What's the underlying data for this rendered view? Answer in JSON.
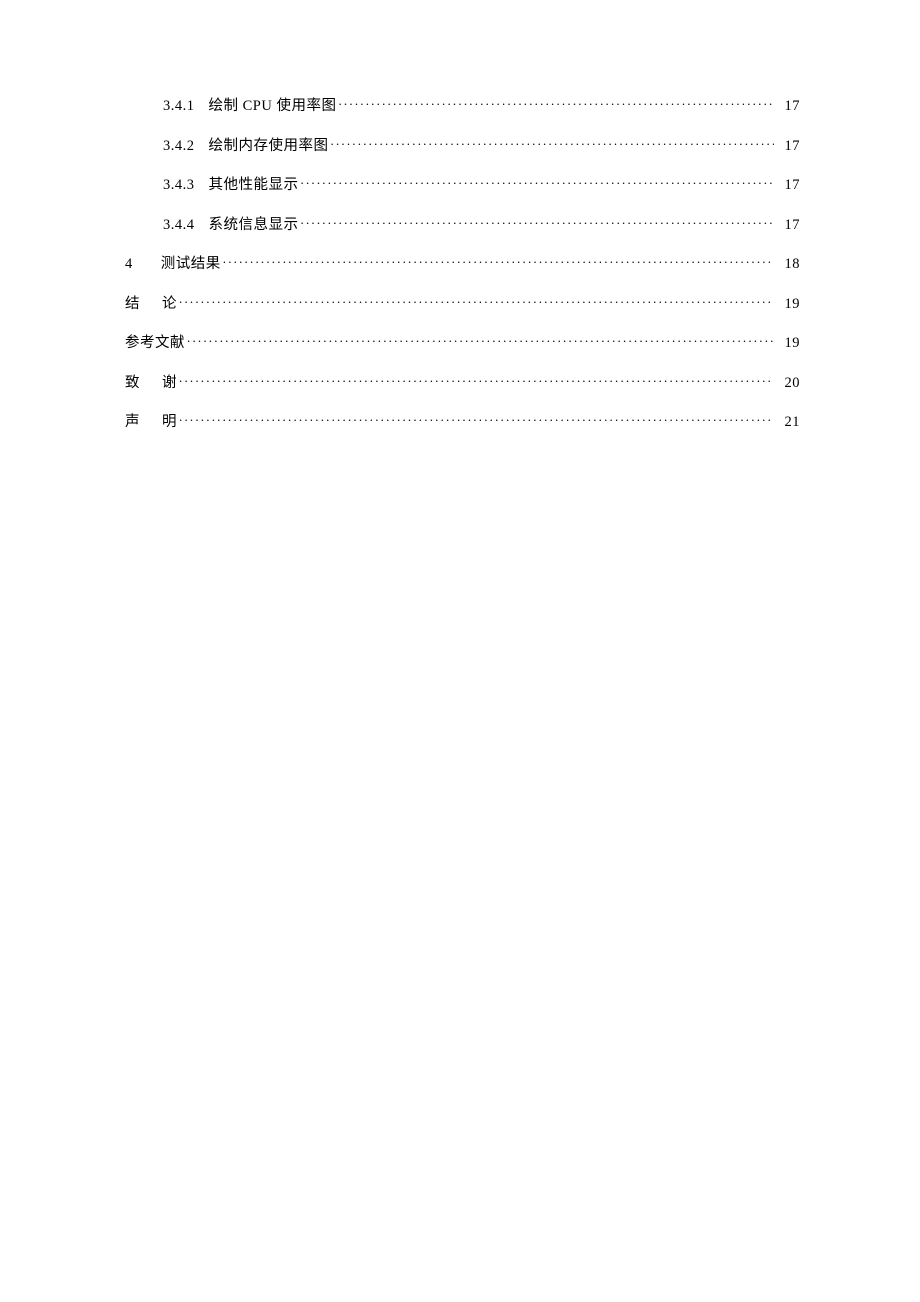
{
  "toc": {
    "entries": [
      {
        "indent": "indent-2",
        "num": "3.4.1",
        "gap": "gap-sm",
        "title": "绘制 CPU 使用率图",
        "spaced": false,
        "page": "17"
      },
      {
        "indent": "indent-2",
        "num": "3.4.2",
        "gap": "gap-sm",
        "title": "绘制内存使用率图",
        "spaced": false,
        "page": "17"
      },
      {
        "indent": "indent-2",
        "num": "3.4.3",
        "gap": "gap-sm",
        "title": "其他性能显示",
        "spaced": false,
        "page": "17"
      },
      {
        "indent": "indent-2",
        "num": "3.4.4",
        "gap": "gap-sm",
        "title": "系统信息显示",
        "spaced": false,
        "page": "17"
      },
      {
        "indent": "indent-0",
        "num": "4",
        "gap": "gap-md",
        "title": "测试结果 ",
        "spaced": false,
        "page": "18"
      },
      {
        "indent": "indent-0",
        "num": "结",
        "gap": "gap-lg",
        "title": "论 ",
        "spaced": false,
        "page": "19"
      },
      {
        "indent": "indent-0",
        "num": "",
        "gap": "",
        "title": "参考文献",
        "spaced": false,
        "page": "19"
      },
      {
        "indent": "indent-0",
        "num": "致",
        "gap": "gap-lg",
        "title": "谢 ",
        "spaced": false,
        "page": "20"
      },
      {
        "indent": "indent-0",
        "num": "声",
        "gap": "gap-lg",
        "title": "明 ",
        "spaced": false,
        "page": "21"
      }
    ]
  }
}
